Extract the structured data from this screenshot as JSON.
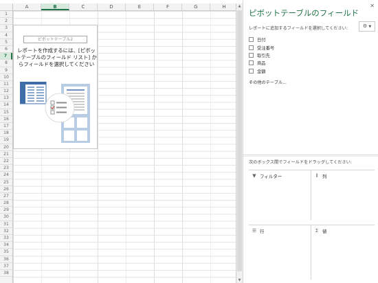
{
  "sheet": {
    "columns": [
      "A",
      "B",
      "C",
      "D",
      "E",
      "F",
      "G",
      "H"
    ],
    "selected_column": "B",
    "rows": [
      "1",
      "2",
      "3",
      "4",
      "5",
      "6",
      "7",
      "8",
      "9",
      "10",
      "11",
      "12",
      "13",
      "14",
      "15",
      "16",
      "17",
      "18",
      "19",
      "20",
      "21",
      "22",
      "23",
      "24",
      "25",
      "26",
      "27",
      "28",
      "29",
      "30",
      "31",
      "32",
      "33",
      "34",
      "35",
      "36",
      "37",
      "38"
    ],
    "selected_row": "7",
    "pivot_placeholder": {
      "name": "ピボットテーブル2",
      "instruction": "レポートを作成するには、[ピボットテーブルのフィールド リスト] からフィールドを選択してください"
    }
  },
  "field_pane": {
    "title": "ピボットテーブルのフィールド",
    "close_icon": "close-icon",
    "choose_label": "レポートに追加するフィールドを選択してください:",
    "tools_button_icon": "gear-icon",
    "fields": [
      {
        "label": "日付",
        "checked": false
      },
      {
        "label": "受注番号",
        "checked": false
      },
      {
        "label": "取引先",
        "checked": false
      },
      {
        "label": "商品",
        "checked": false
      },
      {
        "label": "金額",
        "checked": false
      }
    ],
    "more_tables": "その他のテーブル...",
    "areas_label": "次のボックス間でフィールドをドラッグしてください:",
    "areas": {
      "filters": {
        "label": "フィルター",
        "icon": "filter-icon"
      },
      "columns": {
        "label": "列",
        "icon": "columns-icon"
      },
      "rows": {
        "label": "行",
        "icon": "rows-icon"
      },
      "values": {
        "label": "値",
        "icon": "sigma-icon"
      }
    }
  },
  "colors": {
    "accent": "#217346",
    "selected_header_bg": "#d7e9dc",
    "illustration_blue": "#3d6ea8"
  }
}
